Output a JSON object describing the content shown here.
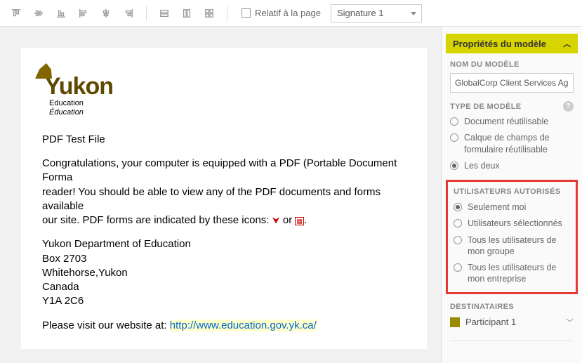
{
  "toolbar": {
    "relative_label": "Relatif à la page",
    "dropdown_value": "Signature 1"
  },
  "document": {
    "logo_text": "Yukon",
    "logo_sub1": "Education",
    "logo_sub2": "Éducation",
    "title": "PDF Test File",
    "para1a": "Congratulations, your computer is equipped with a PDF (Portable Document Forma",
    "para1b": "reader!  You should be able to view any of the PDF documents and forms available",
    "para1c": "our site.  PDF forms are indicated by these icons: ",
    "para1d": " or ",
    "addr1": "Yukon Department of Education",
    "addr2": "Box 2703",
    "addr3": "Whitehorse,Yukon",
    "addr4": "Canada",
    "addr5": "Y1A 2C6",
    "visit_prefix": "Please visit our website at:  ",
    "visit_link": "http://www.education.gov.yk.ca/"
  },
  "sidebar": {
    "panel_title": "Propriétés du modèle",
    "name_label": "NOM DU MODÈLE",
    "name_value": "GlobalCorp Client Services Agreement",
    "type_label": "TYPE DE MODÈLE",
    "type_options": {
      "o1": "Document réutilisable",
      "o2": "Calque de champs de formulaire réutilisable",
      "o3": "Les deux"
    },
    "auth_label": "UTILISATEURS AUTORISÉS",
    "auth_options": {
      "o1": "Seulement moi",
      "o2": "Utilisateurs sélectionnés",
      "o3": "Tous les utilisateurs de mon groupe",
      "o4": "Tous les utilisateurs de mon entreprise"
    },
    "dest_label": "DESTINATAIRES",
    "dest_item": "Participant 1"
  }
}
